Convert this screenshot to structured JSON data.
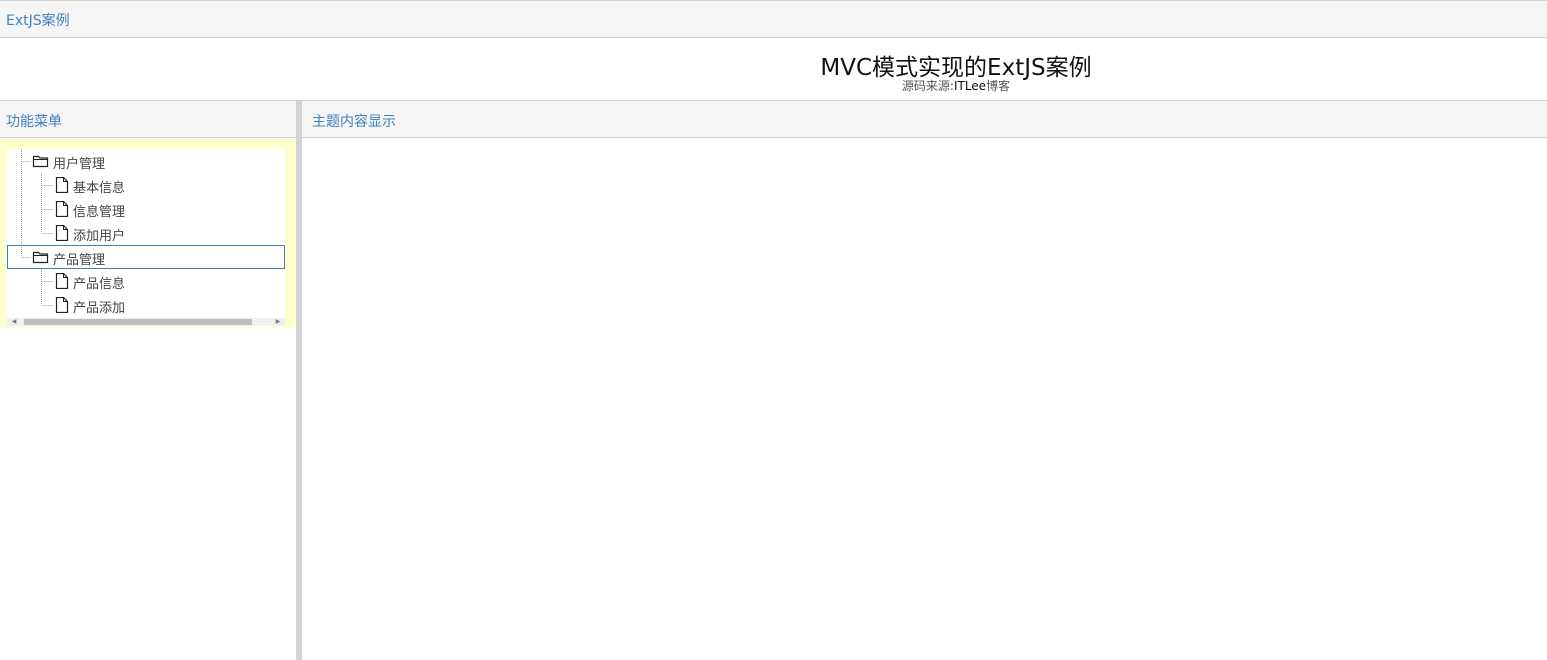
{
  "app": {
    "title": "ExtJS案例"
  },
  "banner": {
    "title": "MVC模式实现的ExtJS案例",
    "subtitle_prefix": "源码来源:",
    "subtitle_link": "ITLee",
    "subtitle_suffix": "博客"
  },
  "west": {
    "title": "功能菜单"
  },
  "center": {
    "title": "主题内容显示"
  },
  "tree": {
    "nodes": [
      {
        "label": "用户管理",
        "type": "folder",
        "expanded": true,
        "selected": false,
        "children": [
          {
            "label": "基本信息",
            "type": "leaf"
          },
          {
            "label": "信息管理",
            "type": "leaf"
          },
          {
            "label": "添加用户",
            "type": "leaf"
          }
        ]
      },
      {
        "label": "产品管理",
        "type": "folder",
        "expanded": true,
        "selected": true,
        "children": [
          {
            "label": "产品信息",
            "type": "leaf"
          },
          {
            "label": "产品添加",
            "type": "leaf"
          }
        ]
      }
    ]
  },
  "colors": {
    "accent": "#3f82c2",
    "tree_background": "#ffffcc",
    "header_bg": "#f5f5f5"
  }
}
